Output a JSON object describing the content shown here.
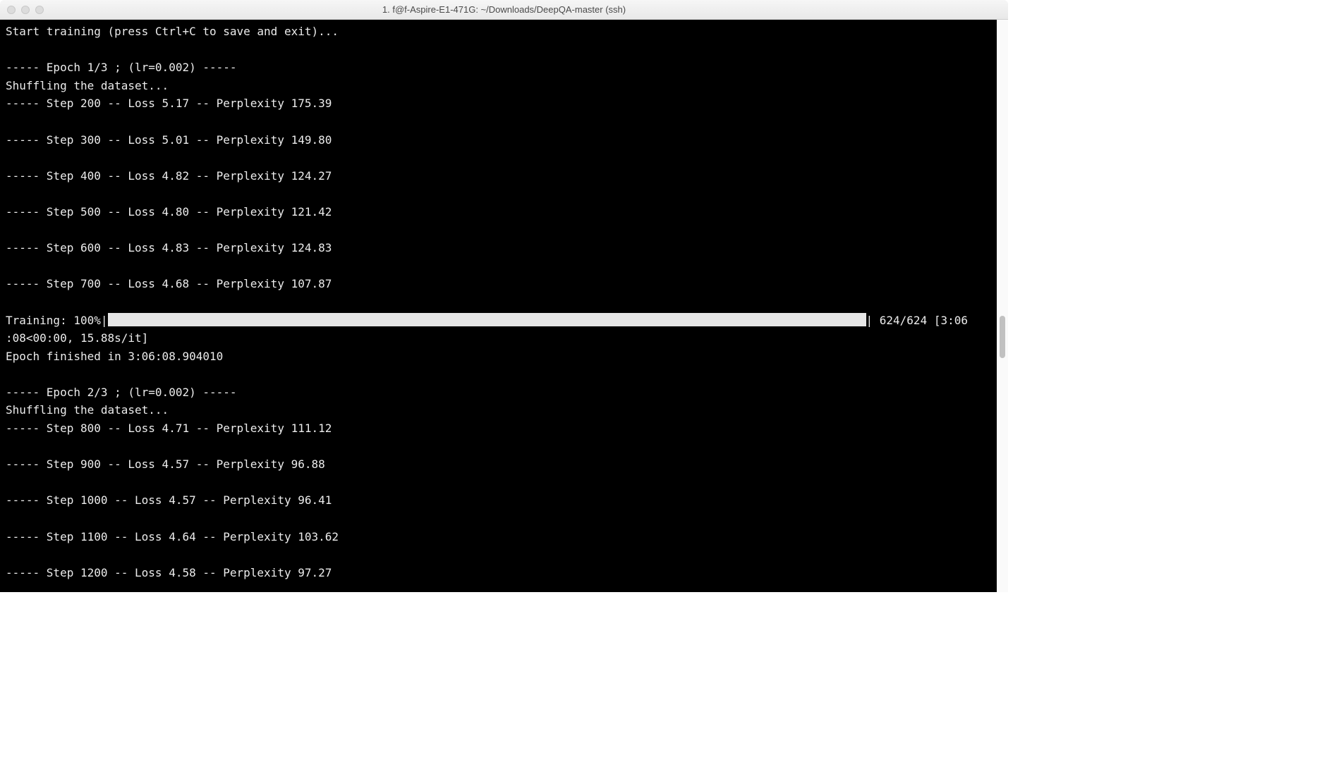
{
  "titlebar": {
    "title": "1. f@f-Aspire-E1-471G: ~/Downloads/DeepQA-master (ssh)"
  },
  "terminal": {
    "line_start": "Start training (press Ctrl+C to save and exit)...",
    "blank": "",
    "epoch1_header": "----- Epoch 1/3 ; (lr=0.002) -----",
    "shuffle1": "Shuffling the dataset...",
    "step200": "----- Step 200 -- Loss 5.17 -- Perplexity 175.39",
    "step300": "----- Step 300 -- Loss 5.01 -- Perplexity 149.80",
    "step400": "----- Step 400 -- Loss 4.82 -- Perplexity 124.27",
    "step500": "----- Step 500 -- Loss 4.80 -- Perplexity 121.42",
    "step600": "----- Step 600 -- Loss 4.83 -- Perplexity 124.83",
    "step700": "----- Step 700 -- Loss 4.68 -- Perplexity 107.87",
    "progress_prefix": "Training: 100%|",
    "progress_suffix": "| 624/624 [3:06",
    "progress_line2": ":08<00:00, 15.88s/it]",
    "epoch_finished": "Epoch finished in 3:06:08.904010",
    "epoch2_header": "----- Epoch 2/3 ; (lr=0.002) -----",
    "shuffle2": "Shuffling the dataset...",
    "step800": "----- Step 800 -- Loss 4.71 -- Perplexity 111.12",
    "step900": "----- Step 900 -- Loss 4.57 -- Perplexity 96.88",
    "step1000": "----- Step 1000 -- Loss 4.57 -- Perplexity 96.41",
    "step1100": "----- Step 1100 -- Loss 4.64 -- Perplexity 103.62",
    "step1200": "----- Step 1200 -- Loss 4.58 -- Perplexity 97.27"
  }
}
